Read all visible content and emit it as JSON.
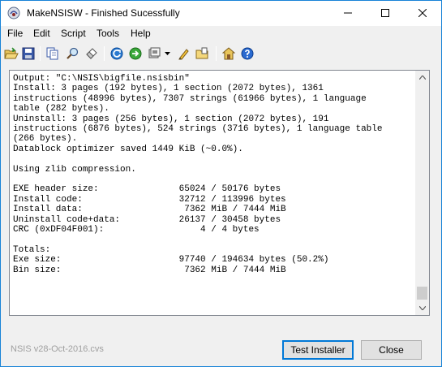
{
  "window": {
    "title": "MakeNSISW - Finished Sucessfully"
  },
  "menu": [
    "File",
    "Edit",
    "Script",
    "Tools",
    "Help"
  ],
  "toolbar": {
    "icons": [
      "open-folder-icon",
      "save-icon",
      "copy-icon",
      "find-icon",
      "clear-icon",
      "recompile-icon",
      "test-icon",
      "compressor-icon",
      "edit-script-icon",
      "browse-script-icon",
      "settings-icon",
      "help-icon"
    ]
  },
  "output": {
    "lines": [
      "Output: \"C:\\NSIS\\bigfile.nsisbin\"",
      "Install: 3 pages (192 bytes), 1 section (2072 bytes), 1361",
      "instructions (48996 bytes), 7307 strings (61966 bytes), 1 language",
      "table (282 bytes).",
      "Uninstall: 3 pages (256 bytes), 1 section (2072 bytes), 191",
      "instructions (6876 bytes), 524 strings (3716 bytes), 1 language table",
      "(266 bytes).",
      "Datablock optimizer saved 1449 KiB (~0.0%).",
      "",
      "Using zlib compression.",
      "",
      "EXE header size:               65024 / 50176 bytes",
      "Install code:                  32712 / 113996 bytes",
      "Install data:                   7362 MiB / 7444 MiB",
      "Uninstall code+data:           26137 / 30458 bytes",
      "CRC (0xDF04F001):                  4 / 4 bytes",
      "",
      "Totals:",
      "Exe size:                      97740 / 194634 bytes (50.2%)",
      "Bin size:                       7362 MiB / 7444 MiB"
    ]
  },
  "footer": {
    "version": "NSIS v28-Oct-2016.cvs",
    "test_button": "Test Installer",
    "close_button": "Close"
  },
  "colors": {
    "accent": "#0078d7",
    "titlebar_border": "#1883d7"
  }
}
